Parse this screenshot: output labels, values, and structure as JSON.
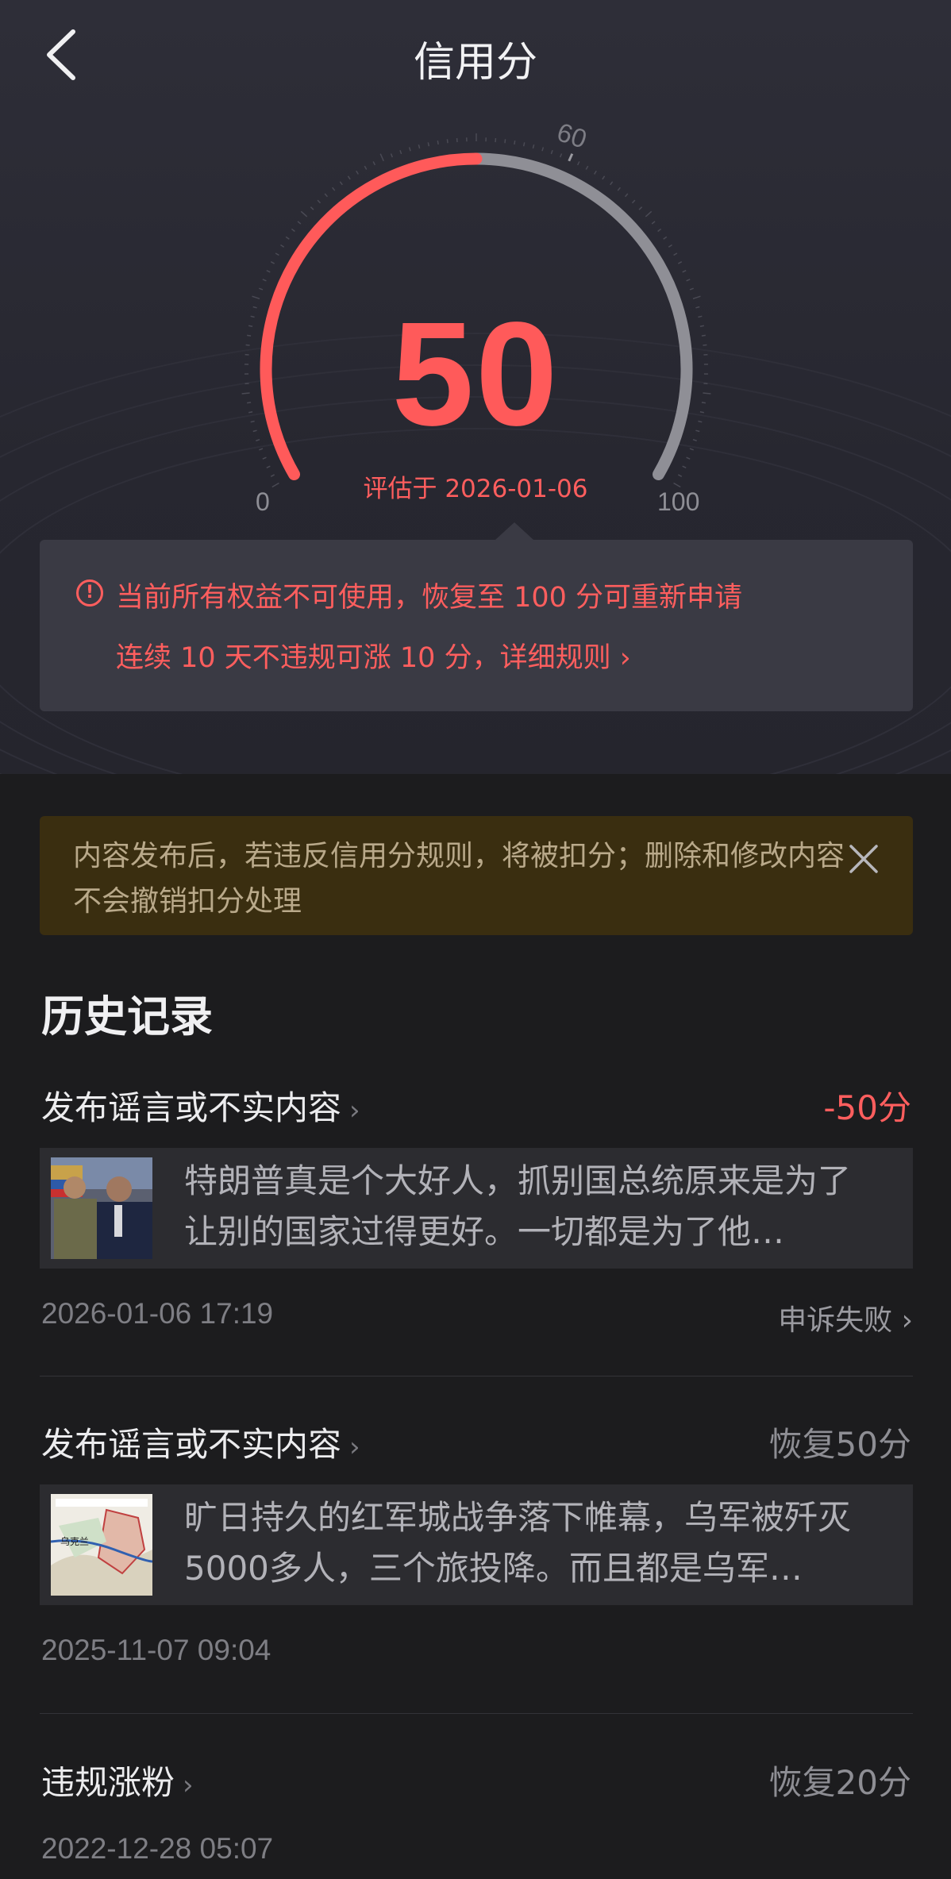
{
  "nav": {
    "title": "信用分",
    "back_icon": "chevron-left-icon"
  },
  "gauge": {
    "score": "50",
    "max": 100,
    "threshold_label": "60",
    "min_label": "0",
    "max_label": "100",
    "evaluated": "评估于 2026-01-06",
    "colors": {
      "filled": "#ff5a5a",
      "track": "#8f8f96"
    }
  },
  "notice": {
    "icon": "exclamation-circle-icon",
    "line1": "当前所有权益不可使用，恢复至 100 分可重新申请",
    "line2": "连续 10 天不违规可涨 10 分，详细规则 ›"
  },
  "banner": {
    "text": "内容发布后，若违反信用分规则，将被扣分；删除和修改内容不会撤销扣分处理",
    "close_icon": "close-icon"
  },
  "history": {
    "title": "历史记录",
    "records": [
      {
        "title": "发布谣言或不实内容",
        "delta": "-50分",
        "snippet": "特朗普真是个大好人，抓别国总统原来是为了让别的国家过得更好。一切都是为了他…",
        "time": "2026-01-06 17:19",
        "status": "申诉失败 ›"
      },
      {
        "title": "发布谣言或不实内容",
        "delta": "恢复50分",
        "snippet": "旷日持久的红军城战争落下帷幕，乌军被歼灭5000多人，三个旅投降。而且都是乌军…",
        "time": "2025-11-07 09:04",
        "thumb_text": "乌克兰"
      },
      {
        "title": "违规涨粉",
        "delta": "恢复20分",
        "time": "2022-12-28 05:07"
      }
    ]
  }
}
